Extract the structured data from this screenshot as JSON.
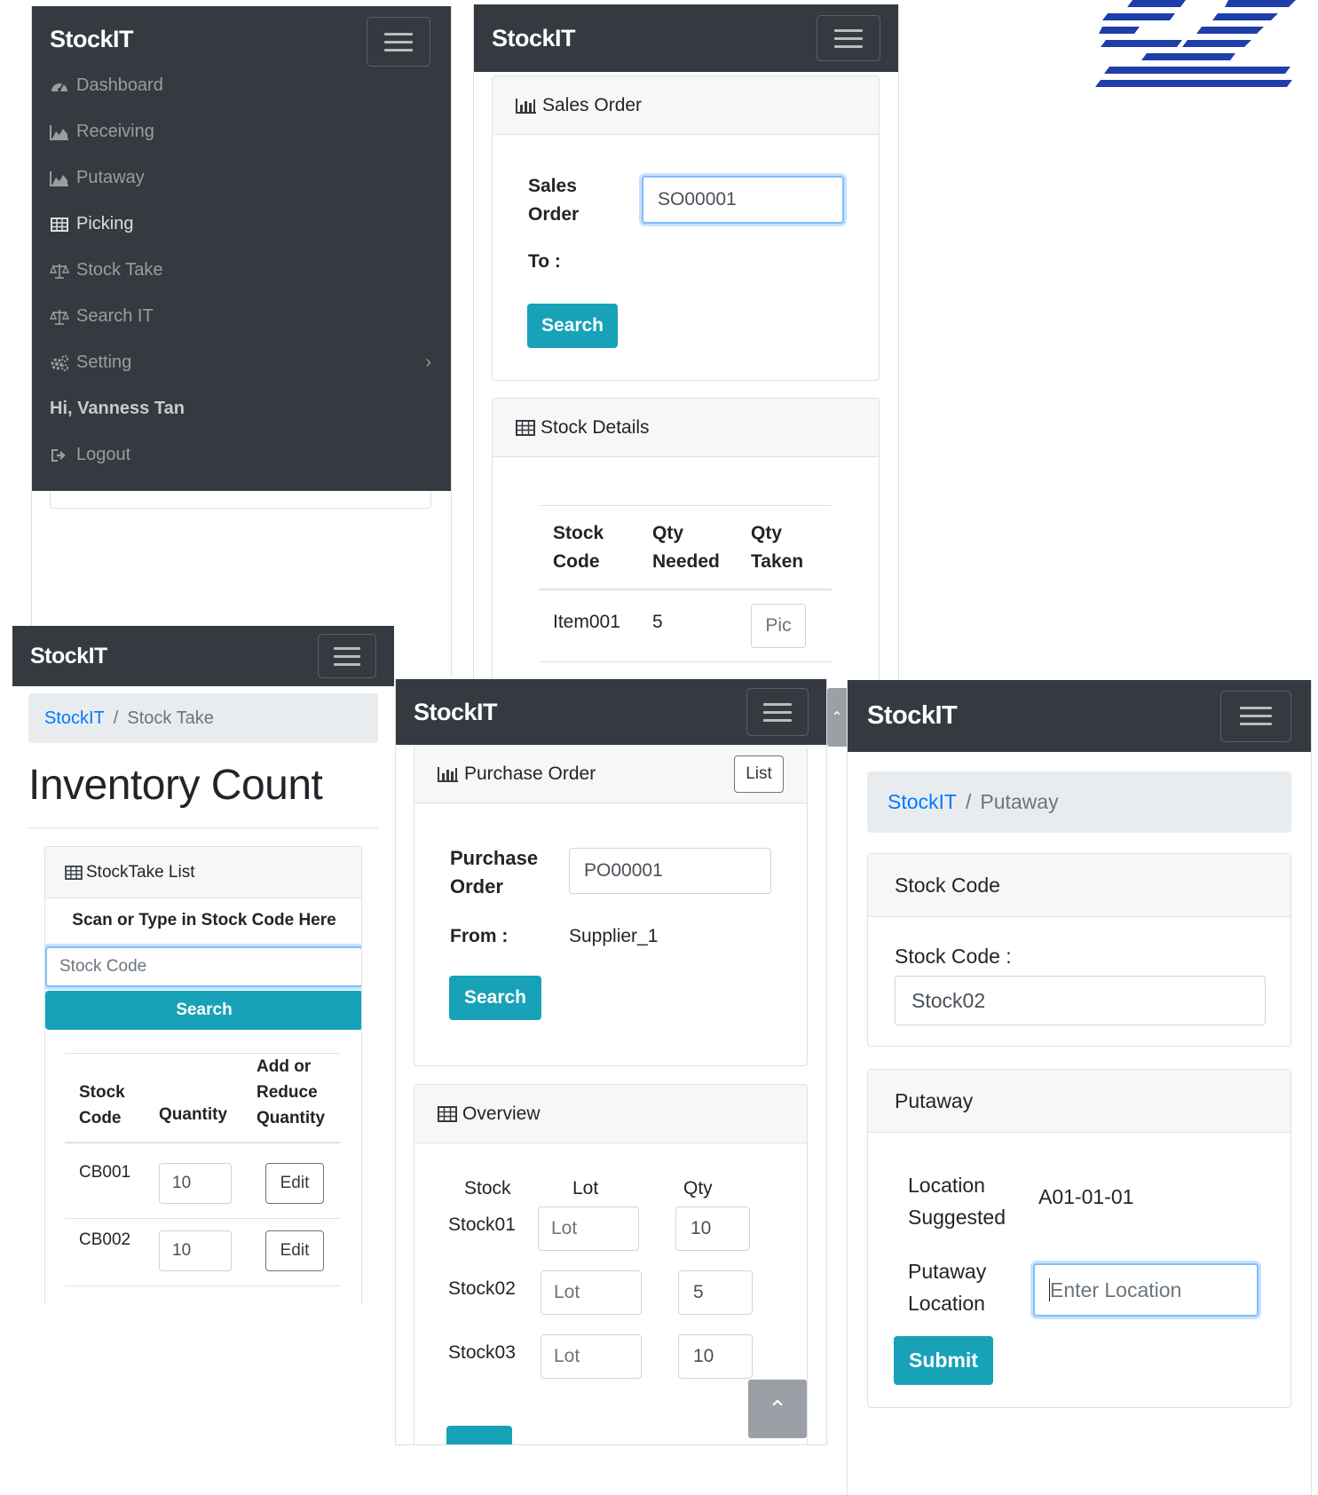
{
  "brand": "StockIT",
  "panel_menu": {
    "items": [
      {
        "label": "Dashboard",
        "icon": "dashboard-icon"
      },
      {
        "label": "Receiving",
        "icon": "area-chart-icon"
      },
      {
        "label": "Putaway",
        "icon": "area-chart-icon"
      },
      {
        "label": "Picking",
        "icon": "table-icon"
      },
      {
        "label": "Stock Take",
        "icon": "balance-scale-icon"
      },
      {
        "label": "Search IT",
        "icon": "balance-scale-icon"
      },
      {
        "label": "Setting",
        "icon": "gears-icon"
      }
    ],
    "greeting": "Hi, Vanness Tan",
    "logout": "Logout"
  },
  "panel_sales": {
    "card_title": "Sales Order",
    "field_label_1": "Sales",
    "field_label_2": "Order",
    "field_value": "SO00001",
    "to_label": "To :",
    "search": "Search",
    "details_title": "Stock Details",
    "columns": [
      [
        "Stock",
        "Code"
      ],
      [
        "Qty",
        "Needed"
      ],
      [
        "Qty",
        "Taken"
      ]
    ],
    "row": {
      "code": "Item001",
      "needed": "5",
      "action": "Pic"
    }
  },
  "panel_stocktake": {
    "crumb_home": "StockIT",
    "crumb_current": "Stock Take",
    "heading": "Inventory Count",
    "card_title": "StockTake List",
    "scan_label": "Scan or Type in Stock Code Here",
    "input_placeholder": "Stock Code",
    "search": "Search",
    "col_code": [
      "Stock",
      "Code"
    ],
    "col_qty": "Quantity",
    "col_adjust": [
      "Add or",
      "Reduce",
      "Quantity"
    ],
    "rows": [
      {
        "code": "CB001",
        "qty": "10",
        "action": "Edit"
      },
      {
        "code": "CB002",
        "qty": "10",
        "action": "Edit"
      }
    ]
  },
  "panel_purchase": {
    "card_title": "Purchase Order",
    "list_btn": "List",
    "po_label": [
      "Purchase",
      "Order"
    ],
    "po_value": "PO00001",
    "from_label": "From :",
    "from_value": "Supplier_1",
    "search": "Search",
    "overview_title": "Overview",
    "col_stock": "Stock",
    "col_lot": "Lot",
    "col_qty": "Qty",
    "rows": [
      {
        "stock": "Stock01",
        "lot": "Lot",
        "qty": "10"
      },
      {
        "stock": "Stock02",
        "lot": "Lot",
        "qty": "5"
      },
      {
        "stock": "Stock03",
        "lot": "Lot",
        "qty": "10"
      }
    ],
    "scroll_top": "⌃"
  },
  "panel_putaway": {
    "crumb_home": "StockIT",
    "crumb_current": "Putaway",
    "card1_title": "Stock Code",
    "stock_label": "Stock Code :",
    "stock_value": "Stock02",
    "card2_title": "Putaway",
    "suggested_label": [
      "Location",
      "Suggested"
    ],
    "suggested_value": "A01-01-01",
    "putaway_label": [
      "Putaway",
      "Location"
    ],
    "location_placeholder": "Enter Location",
    "submit": "Submit"
  },
  "colors": {
    "navbar": "#343a40",
    "accent": "#17a2b8",
    "link": "#007bff",
    "logo": "#1f3ea8"
  }
}
